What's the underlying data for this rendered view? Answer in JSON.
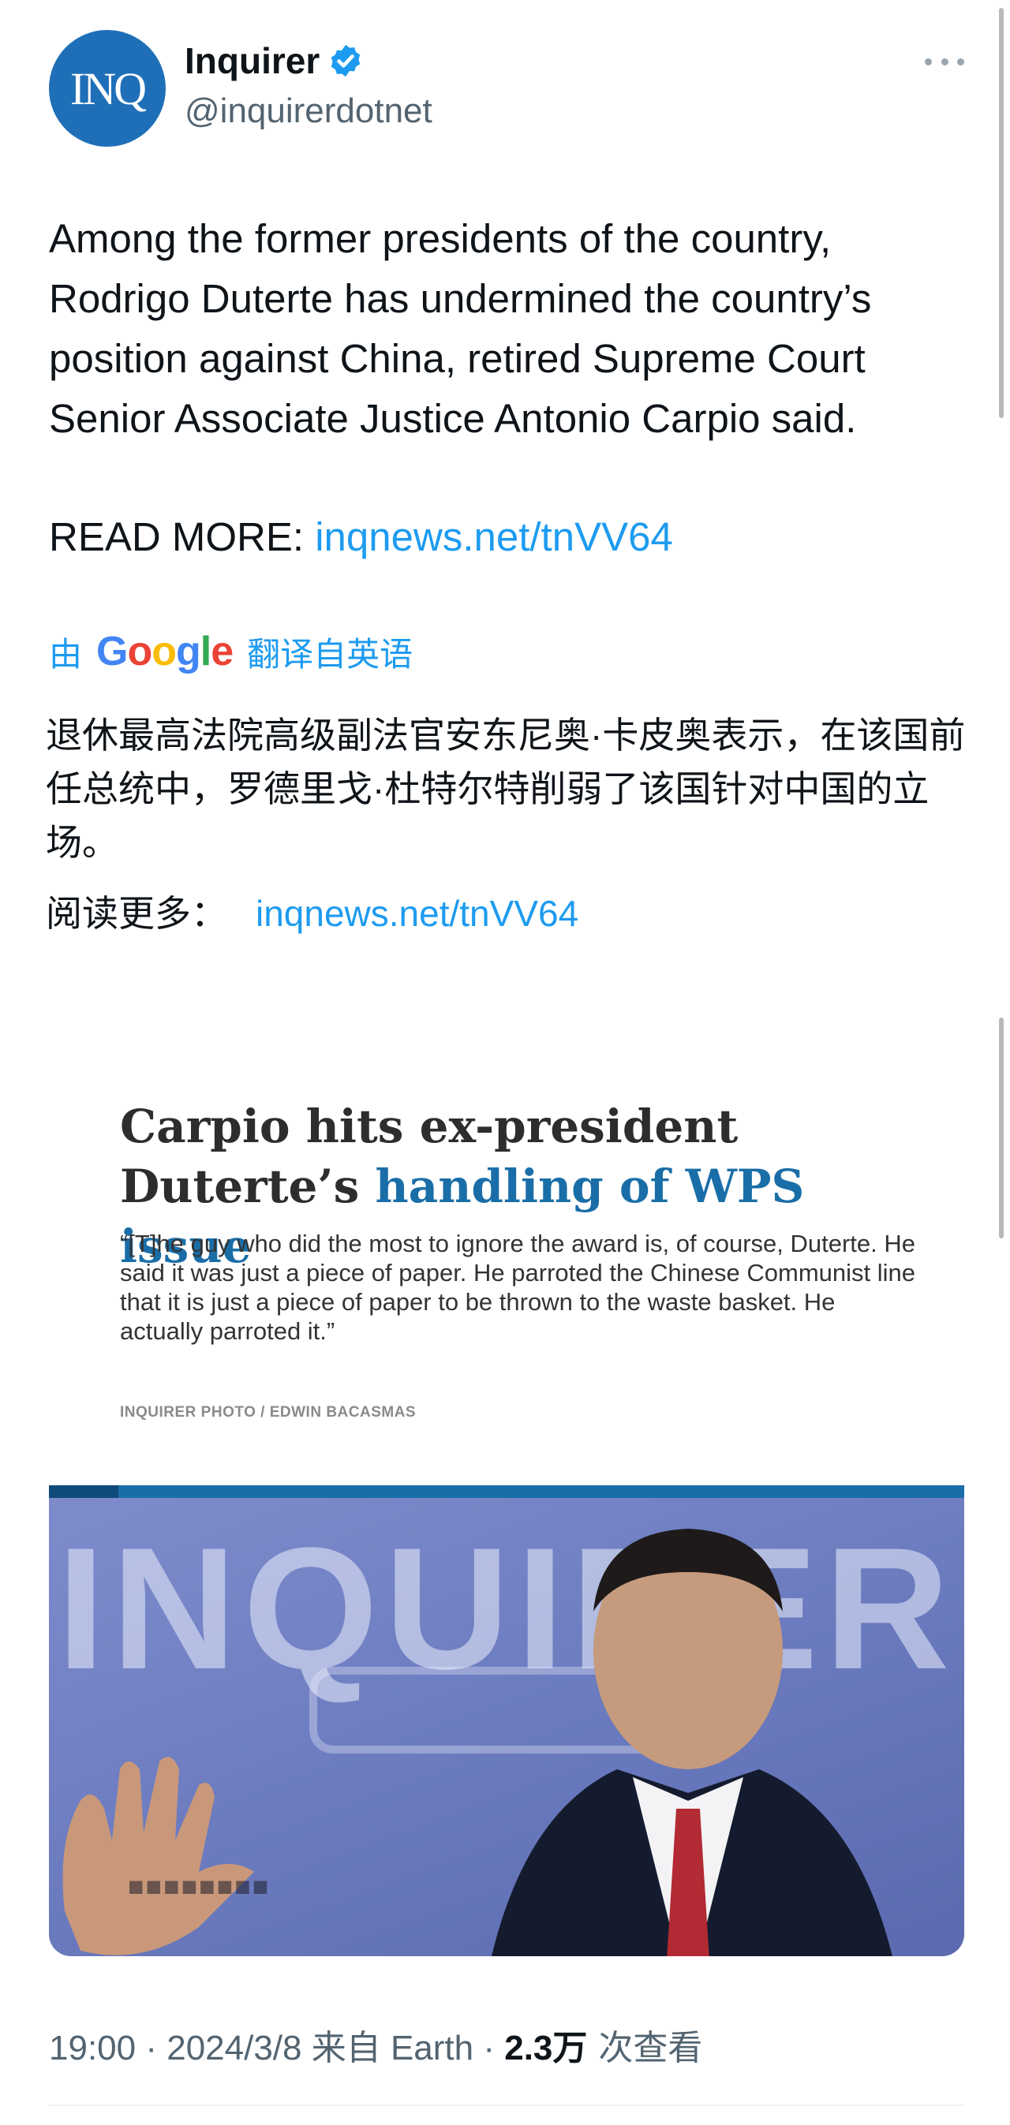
{
  "author": {
    "avatar_text": "INQ",
    "name": "Inquirer",
    "handle": "@inquirerdotnet"
  },
  "tweet": {
    "text": "Among the former presidents of the country, Rodrigo Duterte has undermined the country’s position against China, retired Supreme Court Senior Associate Justice Antonio Carpio said.",
    "read_more_label": "READ MORE: ",
    "link": "inqnews.net/tnVV64"
  },
  "translation": {
    "prefix": "由",
    "provider_letters": [
      "G",
      "o",
      "o",
      "g",
      "l",
      "e"
    ],
    "suffix": "翻译自英语",
    "text": "退休最高法院高级副法官安东尼奥·卡皮奥表示，在该国前任总统中，罗德里戈·杜特尔特削弱了该国针对中国的立场。",
    "read_more_label": "阅读更多：",
    "link": "inqnews.net/tnVV64"
  },
  "article_card": {
    "title_part1": "Carpio hits ex-president Duterte’s ",
    "title_highlight": "handling of WPS issue",
    "quote": "“[T]he guy who did the most to ignore the award is, of course, Duterte. He said it was just a piece of paper. He parroted the Chinese Communist line that it is just a piece of paper to be thrown to the waste basket. He actually parroted it.”",
    "photo_credit": "INQUIRER PHOTO / EDWIN BACASMAS",
    "photo_bg_text": "INQUIRER"
  },
  "meta": {
    "time": "19:00",
    "date": "2024/3/8",
    "source": "来自 Earth",
    "views_count": "2.3万",
    "views_label": "次查看"
  },
  "colors": {
    "link": "#1d9bf0",
    "avatar_bg": "#1f6fb8",
    "headline_highlight": "#1a6ea8",
    "verified": "#1d9bf0"
  }
}
